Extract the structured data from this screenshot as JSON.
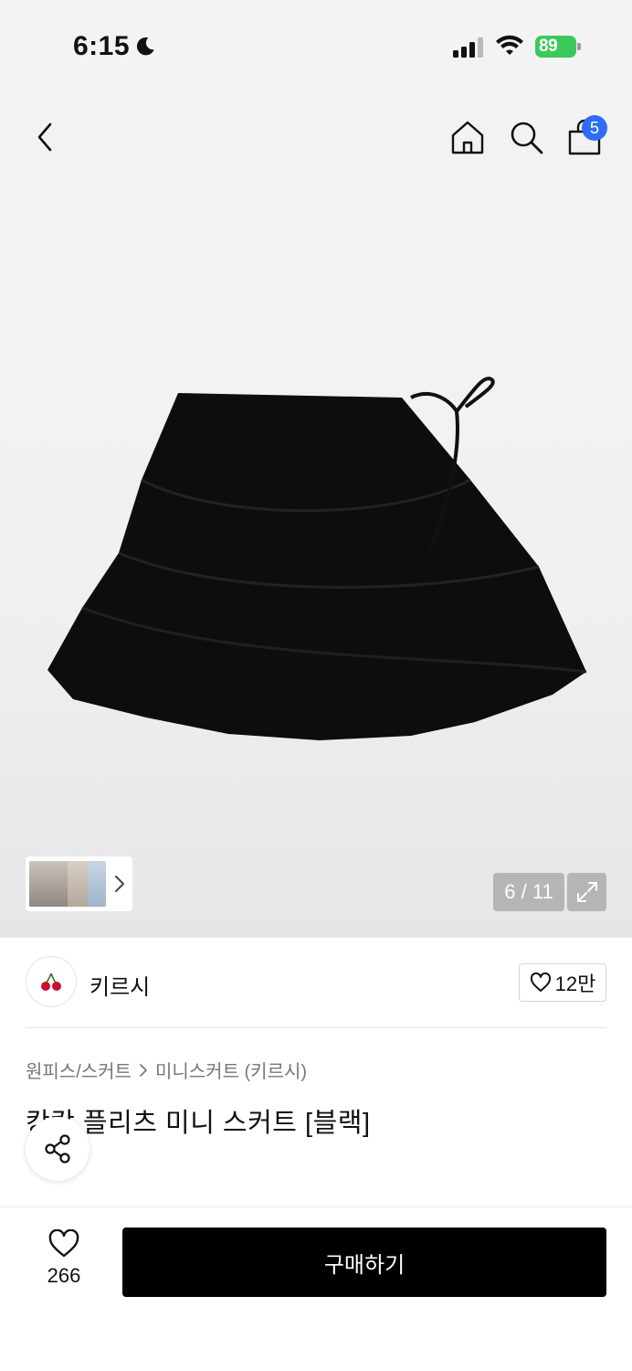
{
  "status_bar": {
    "time": "6:15",
    "battery": "89"
  },
  "header": {
    "cart_count": "5"
  },
  "gallery": {
    "counter": "6 / 11"
  },
  "brand": {
    "name": "키르시",
    "like_count": "12만"
  },
  "product": {
    "breadcrumb": [
      "원피스/스커트",
      "미니스커트 (키르시)"
    ],
    "title": "캉캉 플리츠 미니 스커트 [블랙]"
  },
  "bottom_bar": {
    "wish_count": "266",
    "buy_label": "구매하기"
  },
  "icons": {
    "back": "chevron-left-icon",
    "home": "home-icon",
    "search": "search-icon",
    "cart": "shopping-bag-icon",
    "expand": "expand-icon",
    "share": "share-icon",
    "heart": "heart-icon"
  },
  "colors": {
    "badge": "#2f6cf6",
    "battery": "#3cc95b",
    "buy_button": "#000000"
  }
}
